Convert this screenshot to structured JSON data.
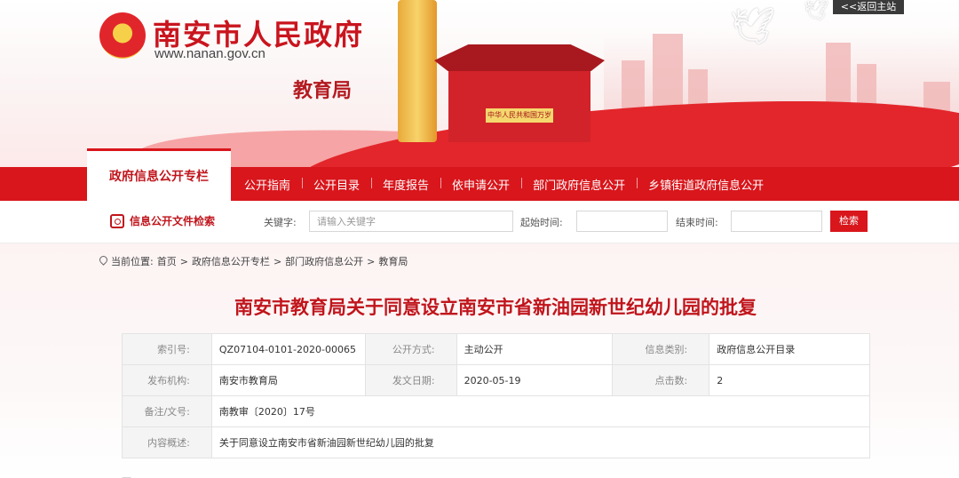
{
  "header": {
    "back_home": "<<返回主站",
    "site_title": "南安市人民政府",
    "site_url": "www.nanan.gov.cn",
    "department": "教育局",
    "gate_board": "中华人民共和国万岁"
  },
  "nav": {
    "active_tab": "政府信息公开专栏",
    "items": [
      "公开指南",
      "公开目录",
      "年度报告",
      "依申请公开",
      "部门政府信息公开",
      "乡镇街道政府信息公开"
    ]
  },
  "search": {
    "label": "信息公开文件检索",
    "keyword_label": "关键字:",
    "keyword_placeholder": "请输入关键字",
    "start_label": "起始时间:",
    "end_label": "结束时间:",
    "button": "检索"
  },
  "breadcrumb": {
    "prefix": "当前位置:",
    "items": [
      "首页",
      "政府信息公开专栏",
      "部门政府信息公开",
      "教育局"
    ],
    "separator": ">"
  },
  "article": {
    "title": "南安市教育局关于同意设立南安市省新油园新世纪幼儿园的批复",
    "meta": {
      "index_label": "索引号:",
      "index_value": "QZ07104-0101-2020-00065",
      "method_label": "公开方式:",
      "method_value": "主动公开",
      "category_label": "信息类别:",
      "category_value": "政府信息公开目录",
      "issuer_label": "发布机构:",
      "issuer_value": "南安市教育局",
      "date_label": "发文日期:",
      "date_value": "2020-05-19",
      "hits_label": "点击数:",
      "hits_value": "2",
      "docno_label": "备注/文号:",
      "docno_value": "南教审〔2020〕17号",
      "summary_label": "内容概述:",
      "summary_value": "关于同意设立南安市省新油园新世纪幼儿园的批复"
    },
    "partial_text": "—"
  },
  "colors": {
    "brand_red": "#d8161c",
    "title_red": "#c0151c"
  }
}
